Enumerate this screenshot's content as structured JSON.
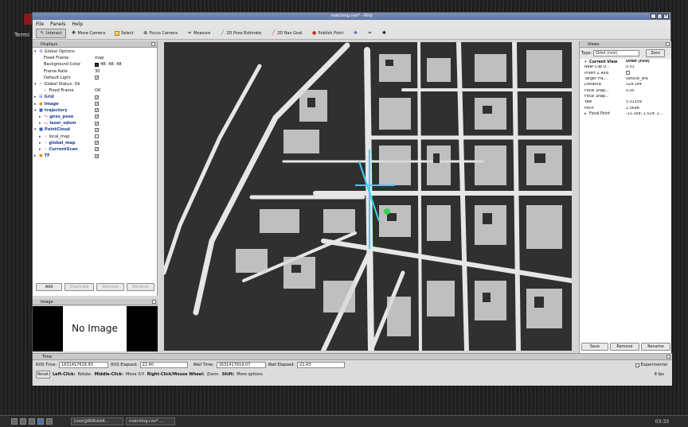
{
  "desktop": {
    "terminal_label": "Termi"
  },
  "window": {
    "title": "matching.rviz* - RViz"
  },
  "menu": [
    "File",
    "Panels",
    "Help"
  ],
  "toolbar": [
    {
      "label": "Interact",
      "icon": "interact-icon"
    },
    {
      "label": "Move Camera",
      "icon": "move-camera-icon"
    },
    {
      "label": "Select",
      "icon": "select-icon"
    },
    {
      "label": "Focus Camera",
      "icon": "focus-camera-icon"
    },
    {
      "label": "Measure",
      "icon": "measure-icon"
    },
    {
      "label": "2D Pose Estimate",
      "icon": "pose-estimate-icon"
    },
    {
      "label": "2D Nav Goal",
      "icon": "nav-goal-icon"
    },
    {
      "label": "Publish Point",
      "icon": "publish-point-icon"
    }
  ],
  "displays": {
    "title": "Displays",
    "rows": [
      {
        "label": "Global Options",
        "value": "",
        "indent": 1,
        "arrow": "▾",
        "icon": "gear-icon"
      },
      {
        "label": "Fixed Frame",
        "value": "map",
        "indent": 2
      },
      {
        "label": "Background Color",
        "value": "48; 48; 48",
        "indent": 2,
        "swatch": true
      },
      {
        "label": "Frame Rate",
        "value": "30",
        "indent": 2
      },
      {
        "label": "Default Light",
        "value": "✓",
        "indent": 2,
        "check": true
      },
      {
        "label": "Global Status: Ok",
        "value": "",
        "indent": 1,
        "arrow": "▾",
        "icon": "check-icon"
      },
      {
        "label": "Fixed Frame",
        "value": "OK",
        "indent": 2,
        "icon": "check-icon"
      },
      {
        "label": "Grid",
        "value": "✓",
        "indent": 1,
        "arrow": "▸",
        "bold": true,
        "check": true,
        "icon": "grid-icon"
      },
      {
        "label": "Image",
        "value": "✓",
        "indent": 1,
        "arrow": "▸",
        "bold": true,
        "check": true,
        "icon": "warning-icon"
      },
      {
        "label": "trajectory",
        "value": "✓",
        "indent": 1,
        "arrow": "▾",
        "bold": true,
        "check": true,
        "icon": "folder-icon"
      },
      {
        "label": "gnss_pose",
        "value": "✓",
        "indent": 2,
        "arrow": "▸",
        "bold": true,
        "check": true,
        "icon": "path-icon"
      },
      {
        "label": "laser_odom",
        "value": "✓",
        "indent": 2,
        "arrow": "▸",
        "bold": true,
        "check": true,
        "icon": "path-icon"
      },
      {
        "label": "PointCloud",
        "value": "✓",
        "indent": 1,
        "arrow": "▾",
        "bold": true,
        "check": true,
        "icon": "folder-icon"
      },
      {
        "label": "local_map",
        "value": "",
        "indent": 2,
        "arrow": "▸",
        "check": true,
        "icon": "pointcloud-icon"
      },
      {
        "label": "global_map",
        "value": "✓",
        "indent": 2,
        "arrow": "▸",
        "bold": true,
        "check": true,
        "icon": "pointcloud-icon"
      },
      {
        "label": "CurrentScan",
        "value": "✓",
        "indent": 2,
        "arrow": "▸",
        "bold": true,
        "check": true,
        "icon": "pointcloud-icon"
      },
      {
        "label": "TF",
        "value": "✓",
        "indent": 1,
        "arrow": "▸",
        "bold": true,
        "check": true,
        "icon": "warning-icon"
      }
    ],
    "buttons": [
      "Add",
      "Duplicate",
      "Remove",
      "Rename"
    ]
  },
  "image_panel": {
    "title": "Image",
    "placeholder": "No Image"
  },
  "views": {
    "title": "Views",
    "type_label": "Type:",
    "type_value": "Orbit (rviz)",
    "zero_label": "Zero",
    "rows": [
      {
        "label": "Current View",
        "value": "Orbit (rviz)",
        "bold": true,
        "arrow": "▾"
      },
      {
        "label": "Near Clip D...",
        "value": "0.01"
      },
      {
        "label": "Invert Z Axis",
        "value": ""
      },
      {
        "label": "Target Fra...",
        "value": "vehicle_link"
      },
      {
        "label": "Distance",
        "value": "529.144"
      },
      {
        "label": "Focal Shap...",
        "value": "0.05"
      },
      {
        "label": "Focal Shap...",
        "value": ""
      },
      {
        "label": "Yaw",
        "value": "5.01359"
      },
      {
        "label": "Pitch",
        "value": "1.5698"
      },
      {
        "label": "Focal Point",
        "value": "-11.168; 1.514; 1...",
        "arrow": "▸"
      }
    ],
    "buttons": [
      "Save",
      "Remove",
      "Rename"
    ]
  },
  "time": {
    "title": "Time",
    "ros_time_label": "ROS Time:",
    "ros_time": "1631417618.93",
    "ros_elapsed_label": "ROS Elapsed:",
    "ros_elapsed": "22.40",
    "wall_time_label": "Wall Time:",
    "wall_time": "1631417619.07",
    "wall_elapsed_label": "Wall Elapsed:",
    "wall_elapsed": "22.43",
    "experimental": "Experimental",
    "reset": "Reset",
    "hint_left": "Left-Click:",
    "hint_left_t": "Rotate.",
    "hint_mid": "Middle-Click:",
    "hint_mid_t": "Move X/Y.",
    "hint_right": "Right-Click/Mouse Wheel:",
    "hint_right_t": "Zoom.",
    "hint_shift": "Shift:",
    "hint_shift_t": "More options.",
    "fps": "8 fps"
  },
  "taskbar": {
    "tasks": [
      "[root@808cbb6...",
      "matching.rviz* ..."
    ],
    "clock": "03:33"
  }
}
